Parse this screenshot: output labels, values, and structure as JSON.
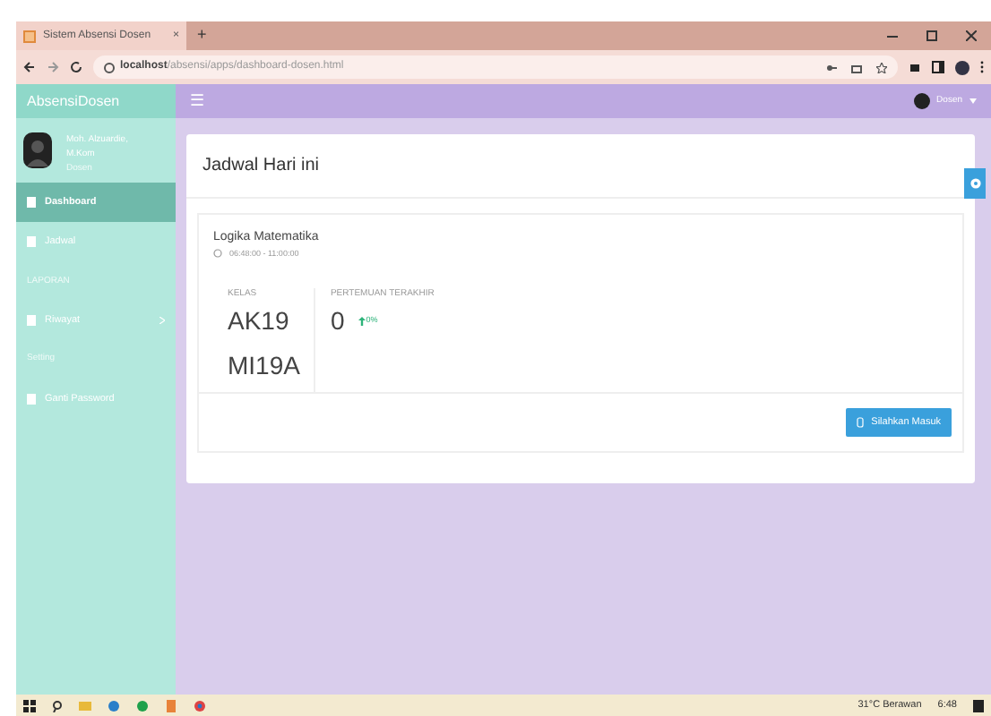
{
  "browser": {
    "tab_title": "Sistem Absensi Dosen",
    "close": "×",
    "new_tab": "+",
    "url_host": "localhost",
    "url_path": "/absensi/apps/dashboard-dosen.html"
  },
  "sidebar": {
    "brand": "AbsensiDosen",
    "user_name": "Moh. Alzuardie, M.Kom",
    "user_role": "Dosen",
    "items": [
      {
        "kind": "link",
        "label": "Dashboard",
        "selected": true
      },
      {
        "kind": "link",
        "label": "Jadwal",
        "selected": false
      },
      {
        "kind": "heading",
        "label": "LAPORAN"
      },
      {
        "kind": "link",
        "label": "Riwayat",
        "selected": false,
        "has_submenu": true
      },
      {
        "kind": "heading",
        "label": "Setting"
      },
      {
        "kind": "link",
        "label": "Ganti Password",
        "selected": false
      }
    ]
  },
  "header": {
    "menu": "☰",
    "user": "Dosen"
  },
  "panel": {
    "title": "Jadwal Hari ini",
    "course": "Logika Matematika",
    "time": "06:48:00 - 11:00:00",
    "class_label": "KELAS",
    "classes": [
      "AK19",
      "MI19A"
    ],
    "meeting_label": "PERTEMUAN TERAKHIR",
    "meeting_value": "0",
    "change": "0%",
    "button": "Silahkan Masuk"
  },
  "taskbar": {
    "weather": "31°C Berawan",
    "time": "6:48"
  }
}
